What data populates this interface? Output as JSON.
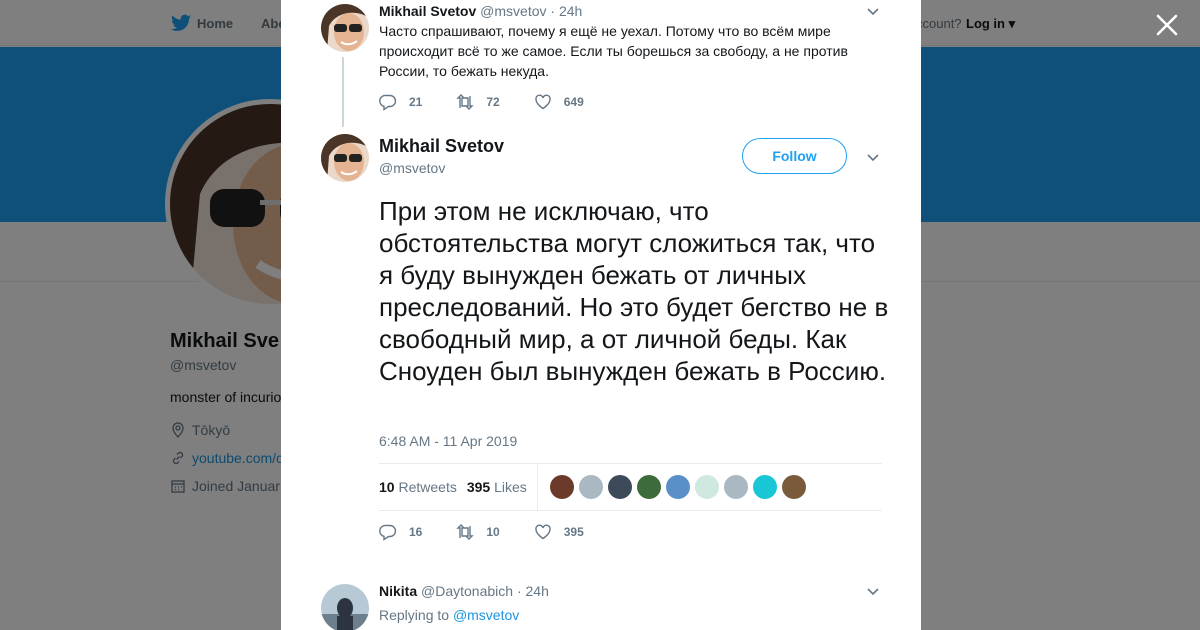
{
  "nav": {
    "home_label": "Home",
    "about_label": "Abo",
    "account_prompt": "ccount?",
    "login_label": "Log in"
  },
  "profile": {
    "name": "Mikhail Sve",
    "handle": "@msvetov",
    "bio": "monster of incurio",
    "location": "Tōkyō",
    "website": "youtube.com/c",
    "joined": "Joined Januar"
  },
  "ancestor_tweet": {
    "author_name": "Mikhail Svetov",
    "author_handle": "@msvetov",
    "time": "· 24h",
    "text": "Часто спрашивают, почему я ещё не уехал. Потому что во всём мире происходит всё то же самое. Если ты борешься за свободу, а не против России, то бежать некуда.",
    "replies": "21",
    "retweets": "72",
    "likes": "649"
  },
  "main_tweet": {
    "author_name": "Mikhail Svetov",
    "author_handle": "@msvetov",
    "follow_label": "Follow",
    "text": "При этом не исключаю, что обстоятельства могут сложиться так, что я буду вынужден бежать от личных преследований. Но это будет бегство не в свободный мир, а от личной беды. Как Сноуден был вынужден бежать в Россию.",
    "timestamp": "6:48 AM - 11 Apr 2019",
    "retweet_count": "10",
    "retweet_label": "Retweets",
    "like_count": "395",
    "like_label": "Likes",
    "replies": "16",
    "retweets": "10",
    "likes": "395",
    "liker_colors": [
      "#6b3a2a",
      "#aab8c2",
      "#3c4a5a",
      "#3d6b3a",
      "#5b8fc7",
      "#cfe8e0",
      "#aab8c2",
      "#19c6d6",
      "#7a5a3a"
    ]
  },
  "reply_tweet": {
    "author_name": "Nikita",
    "author_handle": "@Daytonabich",
    "time": "· 24h",
    "replying_prefix": "Replying to",
    "replying_mention": "@msvetov"
  },
  "colors": {
    "brand": "#1da1f2",
    "link": "#1b95e0"
  }
}
